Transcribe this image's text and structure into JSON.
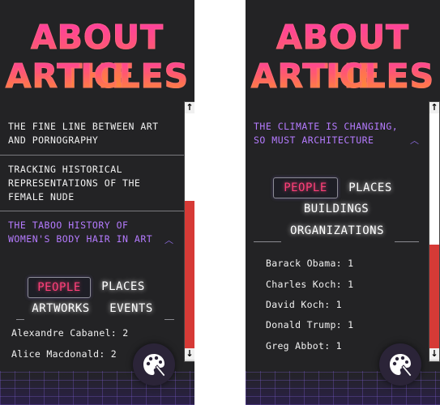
{
  "title_line1": "ABOUT THE",
  "title_line2": "ARTICLES",
  "left": {
    "articles": [
      "THE FINE LINE BETWEEN ART AND PORNOGRAPHY",
      "TRACKING HISTORICAL REPRESENTATIONS OF THE FEMALE NUDE",
      "THE TABOO HISTORY OF WOMEN'S BODY HAIR IN ART"
    ],
    "tabs": [
      "PEOPLE",
      "PLACES",
      "ARTWORKS",
      "EVENTS"
    ],
    "selected_tab": "PEOPLE",
    "entries": [
      "Alexandre Cabanel: 2",
      "Alice Macdonald: 2"
    ]
  },
  "right": {
    "articles": [
      "THE CLIMATE IS CHANGING, SO MUST ARCHITECTURE"
    ],
    "tabs": [
      "PEOPLE",
      "PLACES",
      "BUILDINGS",
      "ORGANIZATIONS"
    ],
    "selected_tab": "PEOPLE",
    "entries": [
      "Barack Obama: 1",
      "Charles Koch: 1",
      "David Koch: 1",
      "Donald Trump: 1",
      "Greg Abbot: 1"
    ]
  },
  "colors": {
    "background": "#232325",
    "active_article": "#b57bff",
    "selected_tab": "#ff3f7a",
    "scroll_thumb": "#d63a36"
  },
  "icons": [
    "chevron-up-icon",
    "palette-icon",
    "scroll-up-arrow",
    "scroll-down-arrow"
  ]
}
